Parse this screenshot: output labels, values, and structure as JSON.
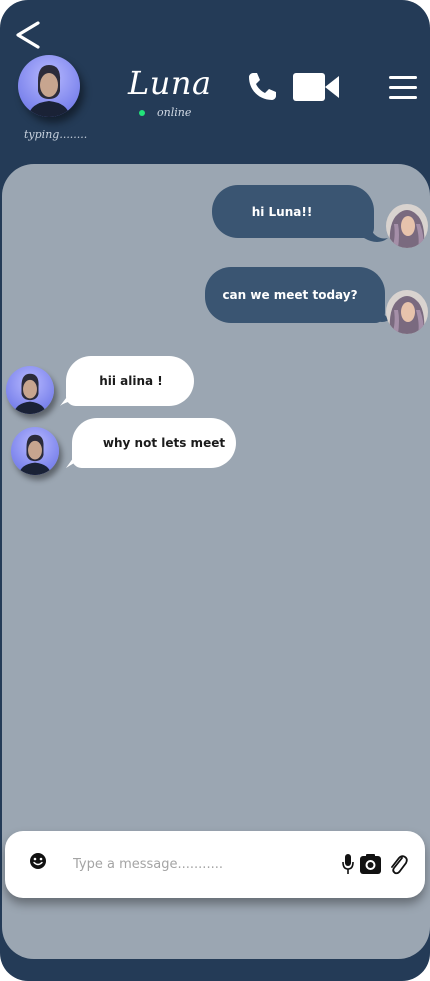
{
  "header": {
    "contact_name": "Luna",
    "status_text": "online",
    "typing_text": "typing........",
    "icons": {
      "back": "back-chevron-icon",
      "call": "phone-icon",
      "video": "video-camera-icon",
      "menu": "hamburger-menu-icon"
    },
    "status_color": "#22e37a"
  },
  "messages": [
    {
      "direction": "outgoing",
      "text": "hi Luna!!"
    },
    {
      "direction": "outgoing",
      "text": "can we meet today?"
    },
    {
      "direction": "incoming",
      "text": "hii alina !"
    },
    {
      "direction": "incoming",
      "text": "why not lets meet"
    }
  ],
  "composer": {
    "placeholder": "Type a message...........",
    "value": "",
    "icons": [
      "smiley-icon",
      "microphone-icon",
      "camera-icon",
      "paperclip-icon"
    ]
  },
  "colors": {
    "header_bg": "#243b57",
    "chat_bg": "#9ba6b2",
    "outgoing_bubble": "#3a5572",
    "incoming_bubble": "#ffffff"
  }
}
